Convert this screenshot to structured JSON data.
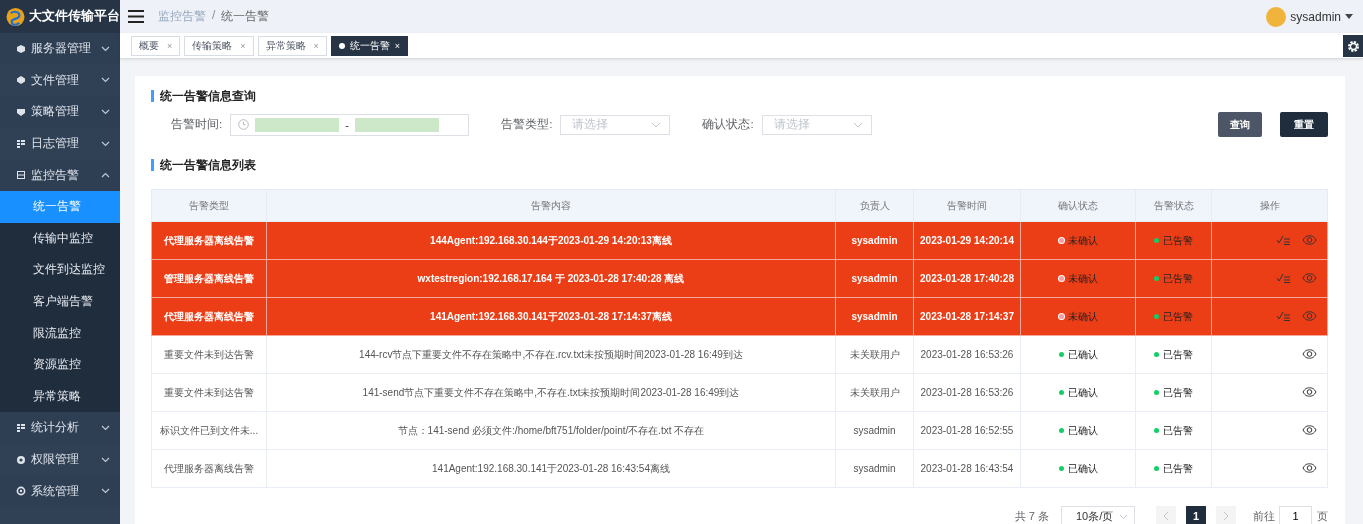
{
  "app": {
    "title": "大文件传输平台"
  },
  "sidebar": {
    "items": [
      {
        "label": "服务器管理",
        "expanded": false
      },
      {
        "label": "文件管理",
        "expanded": false
      },
      {
        "label": "策略管理",
        "expanded": false
      },
      {
        "label": "日志管理",
        "expanded": false
      },
      {
        "label": "监控告警",
        "expanded": true,
        "children": [
          {
            "label": "统一告警",
            "selected": true
          },
          {
            "label": "传输中监控",
            "selected": false
          },
          {
            "label": "文件到达监控",
            "selected": false
          },
          {
            "label": "客户端告警",
            "selected": false
          },
          {
            "label": "限流监控",
            "selected": false
          },
          {
            "label": "资源监控",
            "selected": false
          },
          {
            "label": "异常策略",
            "selected": false
          }
        ]
      },
      {
        "label": "统计分析",
        "expanded": false
      },
      {
        "label": "权限管理",
        "expanded": false
      },
      {
        "label": "系统管理",
        "expanded": false
      }
    ]
  },
  "breadcrumb": [
    "监控告警",
    "统一告警"
  ],
  "breadcrumb_separator": "/",
  "user": {
    "name": "sysadmin"
  },
  "tabs": [
    {
      "label": "概要",
      "selected": false,
      "close": "×"
    },
    {
      "label": "传输策略",
      "selected": false,
      "close": "×"
    },
    {
      "label": "异常策略",
      "selected": false,
      "close": "×"
    },
    {
      "label": "统一告警",
      "selected": true,
      "close": "×"
    }
  ],
  "query": {
    "title": "统一告警信息查询",
    "fields": [
      {
        "kind": "daterange",
        "label": "告警时间:",
        "separator": "-"
      },
      {
        "kind": "select",
        "label": "告警类型:",
        "placeholder": "请选择"
      },
      {
        "kind": "select",
        "label": "确认状态:",
        "placeholder": "请选择"
      }
    ],
    "buttons": [
      {
        "label": "查询",
        "kind": "secondary"
      },
      {
        "label": "重置",
        "kind": "primary"
      }
    ]
  },
  "table": {
    "title": "统一告警信息列表",
    "columns": [
      "告警类型",
      "告警内容",
      "负责人",
      "告警时间",
      "确认状态",
      "告警状态",
      "操作"
    ],
    "rows": [
      {
        "highlighted": true,
        "type": "代理服务器离线告警",
        "content": "144Agent:192.168.30.144于2023-01-29 14:20:13离线",
        "owner": "sysadmin",
        "time": "2023-01-29 14:20:14",
        "confirm": "未确认",
        "confirmed": false,
        "alarm": "已告警"
      },
      {
        "highlighted": true,
        "type": "管理服务器离线告警",
        "content": "wxtestregion:192.168.17.164 于 2023-01-28 17:40:28 离线",
        "owner": "sysadmin",
        "time": "2023-01-28 17:40:28",
        "confirm": "未确认",
        "confirmed": false,
        "alarm": "已告警"
      },
      {
        "highlighted": true,
        "type": "代理服务器离线告警",
        "content": "141Agent:192.168.30.141于2023-01-28 17:14:37离线",
        "owner": "sysadmin",
        "time": "2023-01-28 17:14:37",
        "confirm": "未确认",
        "confirmed": false,
        "alarm": "已告警"
      },
      {
        "highlighted": false,
        "type": "重要文件未到达告警",
        "content": "144-rcv节点下重要文件不存在策略中,不存在.rcv.txt未按预期时间2023-01-28 16:49到达",
        "owner": "未关联用户",
        "time": "2023-01-28 16:53:26",
        "confirm": "已确认",
        "confirmed": true,
        "alarm": "已告警"
      },
      {
        "highlighted": false,
        "type": "重要文件未到达告警",
        "content": "141-send节点下重要文件不存在策略中,不存在.txt未按预期时间2023-01-28 16:49到达",
        "owner": "未关联用户",
        "time": "2023-01-28 16:53:26",
        "confirm": "已确认",
        "confirmed": true,
        "alarm": "已告警"
      },
      {
        "highlighted": false,
        "type": "标识文件已到文件未...",
        "content": "节点：141-send 必须文件:/home/bft751/folder/point/不存在.txt 不存在",
        "owner": "sysadmin",
        "time": "2023-01-28 16:52:55",
        "confirm": "已确认",
        "confirmed": true,
        "alarm": "已告警"
      },
      {
        "highlighted": false,
        "type": "代理服务器离线告警",
        "content": "141Agent:192.168.30.141于2023-01-28 16:43:54离线",
        "owner": "sysadmin",
        "time": "2023-01-28 16:43:54",
        "confirm": "已确认",
        "confirmed": true,
        "alarm": "已告警"
      }
    ]
  },
  "pagination": {
    "total": "共 7 条",
    "page_size": "10条/页",
    "pages": [
      {
        "label": "1",
        "selected": true
      }
    ],
    "goto_label": "前往",
    "goto_value": "1",
    "goto_suffix": "页"
  }
}
